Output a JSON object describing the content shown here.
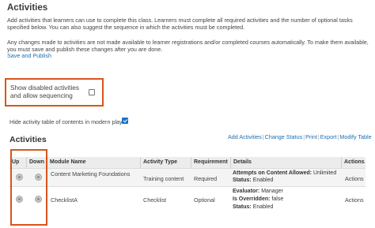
{
  "header": {
    "title": "Activities",
    "intro": "Add activities that learners can use to complete this class. Learners must complete all required activities and the number of optional tasks specified below. You can also suggest the sequence in which the activities must be completed.",
    "changes_note": "Any changes made to activities are not made available to learner registrations and/or completed courses automatically. To make them available, you must save and publish these changes after you are done.",
    "save_publish_link": "Save and Publish"
  },
  "settings": {
    "show_disabled_label": "Show disabled activities and allow sequencing",
    "show_disabled_checked": false,
    "hide_toc_label": "Hide activity table of contents in modern player",
    "hide_toc_checked": true
  },
  "activities": {
    "title": "Activities",
    "toolbar": {
      "add": "Add Activities",
      "change_status": "Change Status",
      "print": "Print",
      "export": "Export",
      "modify_table": "Modify Table",
      "separator": "|"
    },
    "columns": {
      "up": "Up",
      "down": "Down",
      "module_name": "Module Name",
      "activity_type": "Activity Type",
      "requirement": "Requirement",
      "details": "Details",
      "actions": "Actions"
    },
    "rows": [
      {
        "module_name": "Content Marketing Foundations",
        "activity_type": "Training content",
        "requirement": "Required",
        "details": [
          {
            "label": "Attempts on Content Allowed:",
            "value": "Unlimited"
          },
          {
            "label": "Status:",
            "value": "Enabled"
          }
        ],
        "actions": "Actions"
      },
      {
        "module_name": "ChecklistA",
        "activity_type": "Checklist",
        "requirement": "Optional",
        "details": [
          {
            "label": "Evaluator:",
            "value": "Manager"
          },
          {
            "label": "Is Overridden:",
            "value": "false"
          },
          {
            "label": "Status:",
            "value": "Enabled"
          }
        ],
        "actions": "Actions"
      }
    ]
  },
  "colors": {
    "highlight": "#d9541e",
    "link": "#1a6fb3",
    "checkbox_checked": "#1a73c8"
  }
}
